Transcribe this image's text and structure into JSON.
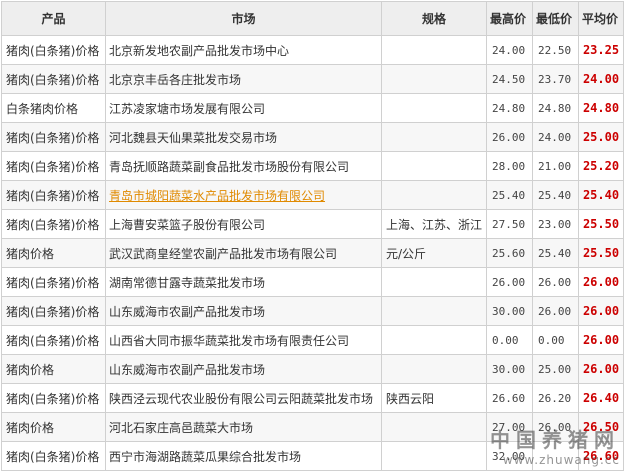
{
  "headers": {
    "product": "产品",
    "market": "市场",
    "spec": "规格",
    "high": "最高价",
    "low": "最低价",
    "avg": "平均价"
  },
  "rows": [
    {
      "product": "猪肉(白条猪)价格",
      "market": "北京新发地农副产品批发市场中心",
      "spec": "",
      "high": "24.00",
      "low": "22.50",
      "avg": "23.25"
    },
    {
      "product": "猪肉(白条猪)价格",
      "market": "北京京丰岳各庄批发市场",
      "spec": "",
      "high": "24.50",
      "low": "23.70",
      "avg": "24.00"
    },
    {
      "product": "白条猪肉价格",
      "market": "江苏凌家塘市场发展有限公司",
      "spec": "",
      "high": "24.80",
      "low": "24.80",
      "avg": "24.80"
    },
    {
      "product": "猪肉(白条猪)价格",
      "market": "河北魏县天仙果菜批发交易市场",
      "spec": "",
      "high": "26.00",
      "low": "24.00",
      "avg": "25.00"
    },
    {
      "product": "猪肉(白条猪)价格",
      "market": "青岛抚顺路蔬菜副食品批发市场股份有限公司",
      "spec": "",
      "high": "28.00",
      "low": "21.00",
      "avg": "25.20"
    },
    {
      "product": "猪肉(白条猪)价格",
      "market": "青岛市城阳蔬菜水产品批发市场有限公司",
      "spec": "",
      "high": "25.40",
      "low": "25.40",
      "avg": "25.40",
      "link": true
    },
    {
      "product": "猪肉(白条猪)价格",
      "market": "上海曹安菜篮子股份有限公司",
      "spec": "上海、江苏、浙江",
      "high": "27.50",
      "low": "23.00",
      "avg": "25.50"
    },
    {
      "product": "猪肉价格",
      "market": "武汉武商皇经堂农副产品批发市场有限公司",
      "spec": "元/公斤",
      "high": "25.60",
      "low": "25.40",
      "avg": "25.50"
    },
    {
      "product": "猪肉(白条猪)价格",
      "market": "湖南常德甘露寺蔬菜批发市场",
      "spec": "",
      "high": "26.00",
      "low": "26.00",
      "avg": "26.00"
    },
    {
      "product": "猪肉(白条猪)价格",
      "market": "山东威海市农副产品批发市场",
      "spec": "",
      "high": "30.00",
      "low": "26.00",
      "avg": "26.00"
    },
    {
      "product": "猪肉(白条猪)价格",
      "market": "山西省大同市振华蔬菜批发市场有限责任公司",
      "spec": "",
      "high": "0.00",
      "low": "0.00",
      "avg": "26.00"
    },
    {
      "product": "猪肉价格",
      "market": "山东威海市农副产品批发市场",
      "spec": "",
      "high": "30.00",
      "low": "25.00",
      "avg": "26.00"
    },
    {
      "product": "猪肉(白条猪)价格",
      "market": "陕西泾云现代农业股份有限公司云阳蔬菜批发市场",
      "spec": "陕西云阳",
      "high": "26.60",
      "low": "26.20",
      "avg": "26.40"
    },
    {
      "product": "猪肉价格",
      "market": "河北石家庄高邑蔬菜大市场",
      "spec": "",
      "high": "27.00",
      "low": "26.00",
      "avg": "26.50"
    },
    {
      "product": "猪肉(白条猪)价格",
      "market": "西宁市海湖路蔬菜瓜果综合批发市场",
      "spec": "",
      "high": "32.00",
      "low": "",
      "avg": "26.60"
    }
  ],
  "watermark": {
    "title": "中国养猪网",
    "url": "www.zhuwang.cc"
  },
  "colors": {
    "avg_price": "#cc0000",
    "link": "#e08a00",
    "header_bg": "#eeeeee",
    "border": "#d0d0d0"
  }
}
